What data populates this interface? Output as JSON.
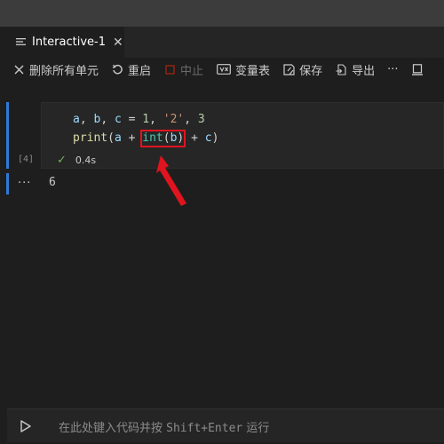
{
  "tab": {
    "title": "Interactive-1",
    "close_glyph": "✕"
  },
  "toolbar": {
    "clear_all": "删除所有单元",
    "restart": "重启",
    "interrupt": "中止",
    "variables": "变量表",
    "save": "保存",
    "export": "导出",
    "more": "···"
  },
  "cell": {
    "execution_count": "[4]",
    "duration": "0.4s",
    "code": {
      "line1": {
        "a": "a",
        "c1": ", ",
        "b": "b",
        "c2": ", ",
        "c": "c",
        "eq": " = ",
        "n1": "1",
        "c3": ", ",
        "s": "'2'",
        "c4": ", ",
        "n3": "3"
      },
      "line2": {
        "print": "print",
        "p1": "(",
        "a": "a",
        "plus1": " + ",
        "int": "int",
        "p2": "(",
        "b": "b",
        "p3": ")",
        "plus2": " + ",
        "c": "c",
        "p4": ")"
      }
    },
    "output_dots": "···",
    "output_value": "6"
  },
  "input": {
    "placeholder_part1": "在此处键入代码并按 ",
    "placeholder_keys": "Shift+Enter",
    "placeholder_part2": " 运行"
  },
  "colors": {
    "accent": "#2f7ad8",
    "highlight_box": "#e0141e",
    "arrow": "#e0141e",
    "success": "#6fb45a"
  }
}
